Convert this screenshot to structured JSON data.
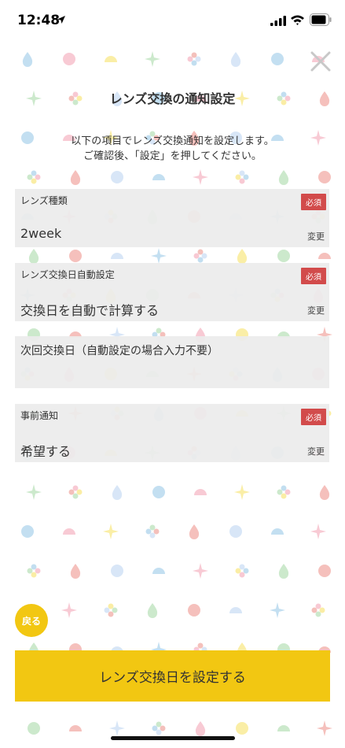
{
  "status_bar": {
    "time": "12:48"
  },
  "title": "レンズ交換の通知設定",
  "intro": {
    "line1": "以下の項目でレンズ交換通知を設定します。",
    "line2": "ご確認後、「設定」を押してください。"
  },
  "fields": [
    {
      "label": "レンズ種類",
      "badge": "必須",
      "value": "2week",
      "change": "変更"
    },
    {
      "label": "レンズ交換日自動設定",
      "badge": "必須",
      "value": "交換日を自動で計算する",
      "change": "変更"
    },
    {
      "label": "次回交換日（自動設定の場合入力不要）",
      "value": ""
    },
    {
      "label": "事前通知",
      "badge": "必須",
      "value": "希望する",
      "change": "変更"
    }
  ],
  "back_button": "戻る",
  "submit_button": "レンズ交換日を設定する",
  "colors": {
    "accent": "#f2c712",
    "required": "#d24b4b",
    "field_bg": "#ececec"
  }
}
